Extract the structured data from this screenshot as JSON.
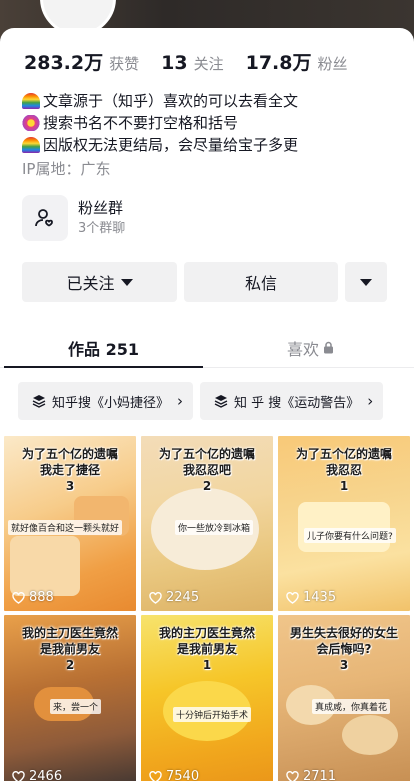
{
  "stats": [
    {
      "num": "283.2万",
      "label": "获赞"
    },
    {
      "num": "13",
      "label": "关注"
    },
    {
      "num": "17.8万",
      "label": "粉丝"
    }
  ],
  "bio": {
    "lines": [
      {
        "icon": "rainbow",
        "text": "文章源于（知乎）喜欢的可以去看全文"
      },
      {
        "icon": "flower",
        "text": "搜索书名不不要打空格和括号"
      },
      {
        "icon": "rainbow",
        "text": "因版权无法更结局，会尽量给宝子多更"
      }
    ],
    "ip": "IP属地：广东"
  },
  "fans_group": {
    "title": "粉丝群",
    "subtitle": "3个群聊"
  },
  "actions": {
    "follow": "已关注",
    "message": "私信"
  },
  "tabs": {
    "works": "作品 251",
    "likes": "喜欢"
  },
  "chips": [
    {
      "label": "知乎搜《小妈捷径》"
    },
    {
      "label": "知 乎 搜《运动警告》"
    }
  ],
  "videos": [
    {
      "caption": "为了五个亿的遗嘱\n我走了捷径\n3",
      "sub": "就好像百合和这一颗头就好",
      "likes": "888"
    },
    {
      "caption": "为了五个亿的遗嘱\n我忍忍吧\n2",
      "sub": "你一些放冷到冰箱",
      "likes": "2245"
    },
    {
      "caption": "为了五个亿的遗嘱\n我忍忍\n1",
      "sub": "儿子你要有什么问题?",
      "likes": "1435"
    },
    {
      "caption": "我的主刀医生竟然\n是我前男友\n2",
      "sub": "来，尝一个",
      "likes": "2466"
    },
    {
      "caption": "我的主刀医生竟然\n是我前男友\n1",
      "sub": "十分钟后开始手术",
      "likes": "7540"
    },
    {
      "caption": "男生失去很好的女生\n会后悔吗?\n3",
      "sub": "真成咸，你真着花",
      "likes": "2711"
    }
  ]
}
